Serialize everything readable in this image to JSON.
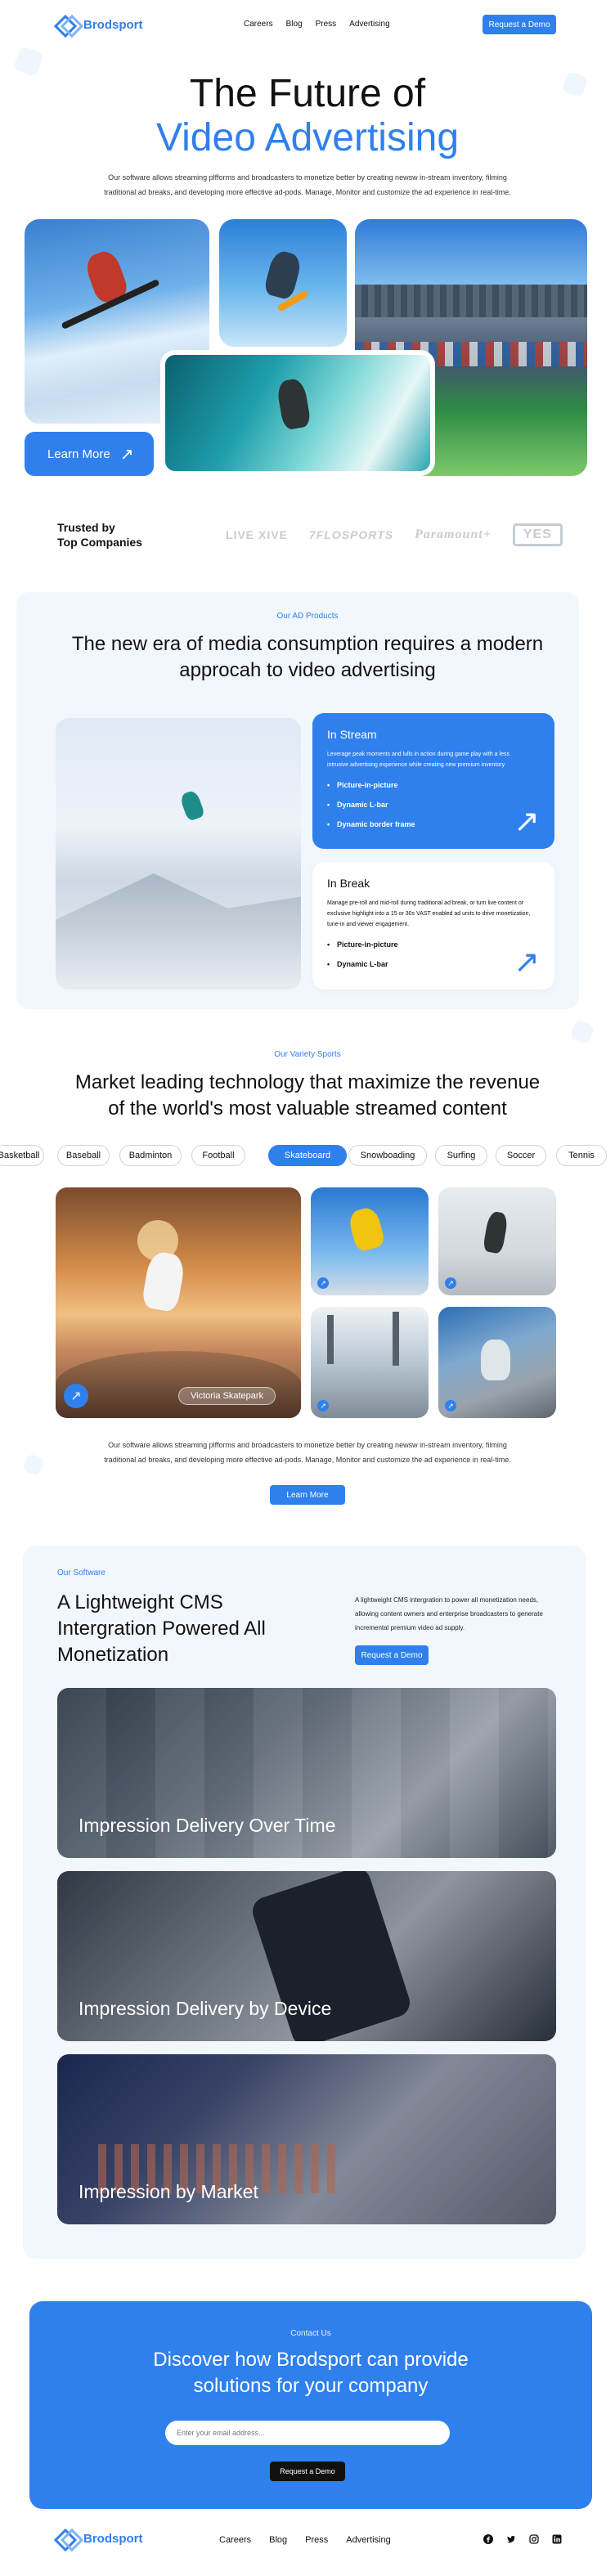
{
  "brand": {
    "name": "Brodsport"
  },
  "nav": {
    "links": [
      "Careers",
      "Blog",
      "Press",
      "Advertising"
    ],
    "cta": "Request a Demo"
  },
  "hero": {
    "title_line1": "The Future of",
    "title_line2": "Video Advertising",
    "description": "Our software allows streaming plfforms and broadcasters to monetize better by creating newsw in-stream inventory, filming traditional ad breaks, and developing more effective ad-pods. Manage, Monitor and customize the ad experience in real-time.",
    "learn_more": "Learn More"
  },
  "trusted": {
    "label_line1": "Trusted by",
    "label_line2": "Top Companies",
    "brands": [
      "LIVE XIVE",
      "7FLOSPORTS",
      "Paramount+",
      "YES"
    ]
  },
  "ad_products": {
    "eyebrow": "Our AD Products",
    "title_line1": "The new era of media consumption requires a modern",
    "title_line2": "approcah to video advertising",
    "in_stream": {
      "title": "In Stream",
      "description": "Leverage peak moments and lulls in action during game play with a less intrusive advertising experience while creating new premium inventory",
      "items": [
        "Picture-in-picture",
        "Dynamic L-bar",
        "Dynamic border frame"
      ]
    },
    "in_break": {
      "title": "In Break",
      "description": "Manage pre-roll and mid-roll during traditional ad break, or turn live content or exclusive highlight into a 15 or 30s VAST enabled ad units to drive monetization, tune-in and viewer engagement.",
      "items": [
        "Picture-in-picture",
        "Dynamic L-bar"
      ]
    }
  },
  "sports": {
    "eyebrow": "Our Variety Sports",
    "title_line1": "Market leading technology that maximize the revenue",
    "title_line2": "of the world's most valuable streamed content",
    "pills": [
      "Basketball",
      "Baseball",
      "Badminton",
      "Football",
      "Skateboard",
      "Snowboading",
      "Surfing",
      "Soccer",
      "Tennis"
    ],
    "active_pill": "Skateboard",
    "location_tag": "Victoria Skatepark",
    "description": "Our software allows streaming plfforms and broadcasters to monetize better by creating newsw in-stream inventory, filming traditional ad breaks, and developing more effective ad-pods. Manage, Monitor and customize the ad experience in real-time.",
    "cta": "Learn More"
  },
  "software": {
    "eyebrow": "Our Software",
    "title": "A Lightweight CMS Intergration Powered All Monetization",
    "description": "A lightweight CMS intergration to power all monetization needs, allowing content owners and enterprise broadcasters to generate incremental premium video ad supply.",
    "cta": "Request a Demo",
    "cards": [
      "Impression Delivery Over Time",
      "Impression Delivery by Device",
      "Impression by Market"
    ]
  },
  "contact": {
    "eyebrow": "Contact Us",
    "title_line1": "Discover how Brodsport can provide",
    "title_line2": "solutions for your company",
    "email_placeholder": "Enter your email address...",
    "cta": "Request a Demo"
  },
  "footer": {
    "links": [
      "Careers",
      "Blog",
      "Press",
      "Advertising"
    ],
    "social_icons": [
      "facebook-icon",
      "twitter-icon",
      "instagram-icon",
      "linkedin-icon"
    ]
  },
  "colors": {
    "accent": "#2f80ed",
    "section_bg": "#f2f7fe",
    "dark": "#111111"
  }
}
